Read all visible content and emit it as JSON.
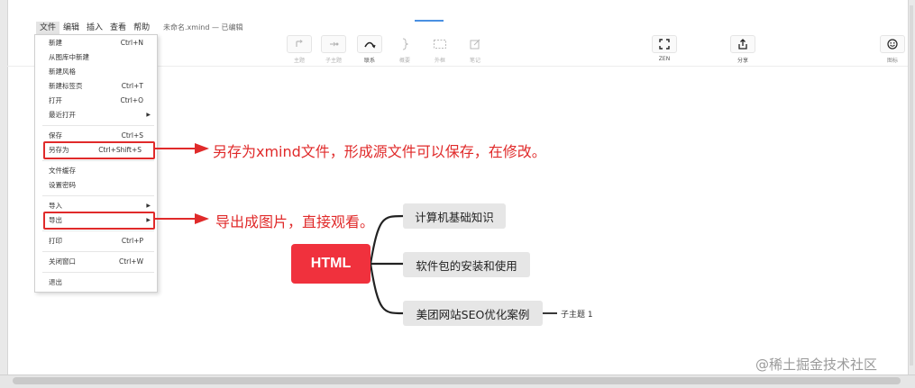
{
  "menubar": {
    "items": [
      {
        "label": "文件"
      },
      {
        "label": "编辑"
      },
      {
        "label": "插入"
      },
      {
        "label": "查看"
      },
      {
        "label": "帮助"
      }
    ],
    "doc_title": "未命名.xmind — 已编辑"
  },
  "toolbar": {
    "topic_label": "主题",
    "subtopic_label": "子主题",
    "relationship_label": "联系",
    "summary_label": "概要",
    "boundary_label": "外框",
    "note_label": "笔记",
    "zen_label": "ZEN",
    "share_label": "分享",
    "icon_label": "图标"
  },
  "file_menu": {
    "new": {
      "label": "新建",
      "shortcut": "Ctrl+N"
    },
    "new_from_library": {
      "label": "从图库中新建"
    },
    "new_style": {
      "label": "新建风格"
    },
    "new_tab": {
      "label": "新建标签页",
      "shortcut": "Ctrl+T"
    },
    "open": {
      "label": "打开",
      "shortcut": "Ctrl+O"
    },
    "recent": {
      "label": "最近打开"
    },
    "save": {
      "label": "保存",
      "shortcut": "Ctrl+S"
    },
    "save_as": {
      "label": "另存为",
      "shortcut": "Ctrl+Shift+S"
    },
    "file_cache": {
      "label": "文件缓存"
    },
    "set_password": {
      "label": "设置密码"
    },
    "import": {
      "label": "导入"
    },
    "export": {
      "label": "导出"
    },
    "print": {
      "label": "打印",
      "shortcut": "Ctrl+P"
    },
    "close_window": {
      "label": "关闭窗口",
      "shortcut": "Ctrl+W"
    },
    "quit": {
      "label": "退出"
    }
  },
  "annotations": {
    "save_as_note": "另存为xmind文件，形成源文件可以保存，在修改。",
    "export_note": "导出成图片，直接观看。"
  },
  "mindmap": {
    "root": "HTML",
    "topics": [
      "计算机基础知识",
      "软件包的安装和使用",
      "美团网站SEO优化案例"
    ],
    "subtopic": "子主题 1"
  },
  "watermark": "@稀土掘金技术社区",
  "colors": {
    "accent_red": "#e02a2a",
    "root_node": "#f0313d",
    "topic_bg": "#e6e6e6"
  }
}
